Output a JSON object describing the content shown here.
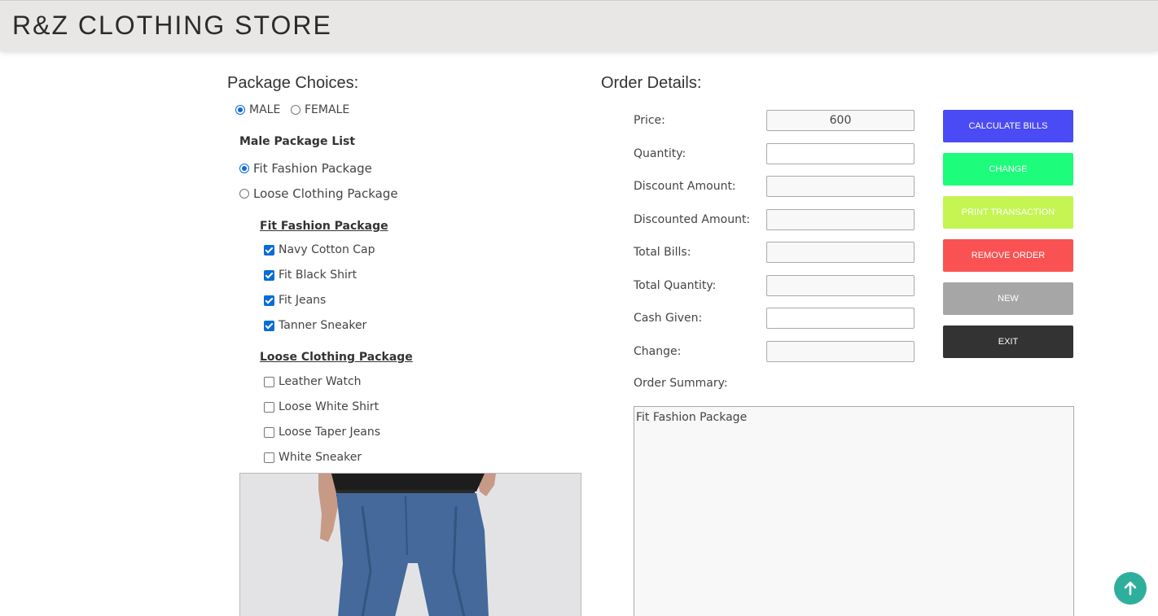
{
  "header": {
    "brand": "R&Z CLOTHING STORE"
  },
  "package_choices": {
    "title": "Package Choices:",
    "gender": [
      {
        "label": "MALE",
        "checked": true
      },
      {
        "label": "FEMALE",
        "checked": false
      }
    ],
    "list_title": "Male Package List",
    "packages": [
      {
        "label": "Fit Fashion Package",
        "checked": true
      },
      {
        "label": "Loose Clothing Package",
        "checked": false
      }
    ],
    "fit_title": "Fit Fashion Package",
    "fit_items": [
      {
        "label": "Navy Cotton Cap",
        "checked": true
      },
      {
        "label": "Fit Black Shirt",
        "checked": true
      },
      {
        "label": "Fit Jeans",
        "checked": true
      },
      {
        "label": "Tanner Sneaker",
        "checked": true
      }
    ],
    "loose_title": "Loose Clothing Package",
    "loose_items": [
      {
        "label": "Leather Watch",
        "checked": false
      },
      {
        "label": "Loose White Shirt",
        "checked": false
      },
      {
        "label": "Loose Taper Jeans",
        "checked": false
      },
      {
        "label": "White Sneaker",
        "checked": false
      }
    ]
  },
  "order": {
    "title": "Order Details:",
    "fields": [
      {
        "label": "Price:",
        "value": "600"
      },
      {
        "label": "Quantity:",
        "value": ""
      },
      {
        "label": "Discount Amount:",
        "value": ""
      },
      {
        "label": "Discounted Amount:",
        "value": ""
      },
      {
        "label": "Total Bills:",
        "value": ""
      },
      {
        "label": "Total Quantity:",
        "value": ""
      },
      {
        "label": "Cash Given:",
        "value": ""
      },
      {
        "label": "Change:",
        "value": ""
      }
    ],
    "summary_label": "Order Summary:",
    "summary_text": "Fit Fashion Package"
  },
  "buttons": [
    {
      "label": "CALCULATE BILLS",
      "color": "#4b4bf5"
    },
    {
      "label": "CHANGE",
      "color": "#1dfc7a"
    },
    {
      "label": "PRINT TRANSACTION",
      "color": "#c4f552"
    },
    {
      "label": "REMOVE ORDER",
      "color": "#fa5252"
    },
    {
      "label": "NEW",
      "color": "#a6a6a6"
    },
    {
      "label": "EXIT",
      "color": "#333333"
    }
  ],
  "icons": {
    "scroll_top": "arrow-up-icon"
  }
}
